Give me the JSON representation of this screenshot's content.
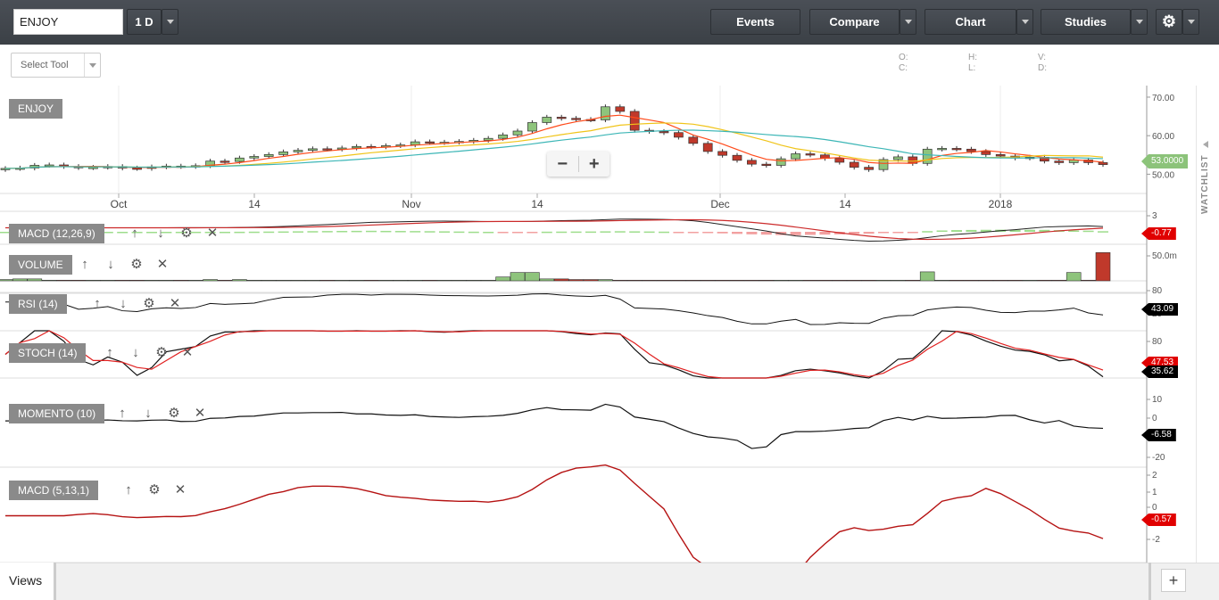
{
  "toolbar": {
    "symbol": "ENJOY",
    "period": "1 D",
    "events": "Events",
    "compare": "Compare",
    "chart": "Chart",
    "studies": "Studies"
  },
  "tools": {
    "select_tool": "Select Tool"
  },
  "ohlc": {
    "o": "O:",
    "h": "H:",
    "v": "V:",
    "c": "C:",
    "l": "L:",
    "d": "D:"
  },
  "main_panel": {
    "label": "ENJOY",
    "y_ticks": [
      "70.00",
      "60.00",
      "50.00"
    ],
    "x_ticks": [
      "Oct",
      "14",
      "Nov",
      "14",
      "Dec",
      "14",
      "2018"
    ],
    "last_price": "53.0000"
  },
  "panels": [
    {
      "label": "MACD (12,26,9)",
      "ticks": [
        "3"
      ],
      "value": "-0.77",
      "controls": [
        "up",
        "down",
        "settings",
        "close"
      ]
    },
    {
      "label": "VOLUME",
      "ticks": [
        "50.0m"
      ],
      "controls": [
        "up",
        "down",
        "settings",
        "close"
      ]
    },
    {
      "label": "RSI (14)",
      "ticks": [
        "80",
        "20"
      ],
      "value": "43.09",
      "controls": [
        "up",
        "down",
        "settings",
        "close"
      ]
    },
    {
      "label": "STOCH (14)",
      "ticks": [
        "80",
        "20"
      ],
      "value": "47.53",
      "value2": "35.62",
      "controls": [
        "up",
        "down",
        "settings",
        "close"
      ]
    },
    {
      "label": "MOMENTO (10)",
      "ticks": [
        "10",
        "0",
        "-10",
        "-20"
      ],
      "value": "-6.58",
      "controls": [
        "up",
        "down",
        "settings",
        "close"
      ]
    },
    {
      "label": "MACD (5,13,1)",
      "ticks": [
        "2",
        "1",
        "0",
        "-1",
        "-2"
      ],
      "value": "-0.57",
      "controls": [
        "up",
        "settings",
        "close"
      ]
    }
  ],
  "zoom": {
    "minus": "−",
    "plus": "+"
  },
  "watchlist": {
    "label": "WATCHLIST"
  },
  "views": {
    "label": "Views",
    "add": "+"
  },
  "colors": {
    "up": "#8ec47c",
    "down": "#c0392b",
    "macd": "#cc2a2a",
    "tag_red": "#e00000",
    "tag_green": "#8cc37a",
    "tag_black": "#000000"
  },
  "chart_data": {
    "type": "candlestick",
    "price_ylim": [
      45,
      73
    ],
    "close": [
      51.5,
      51.6,
      52.3,
      52.4,
      52.0,
      51.7,
      51.8,
      52.0,
      51.6,
      51.5,
      51.9,
      52.1,
      52.0,
      52.2,
      53.4,
      53.3,
      54.2,
      54.6,
      55.1,
      55.8,
      56.2,
      56.6,
      56.5,
      56.8,
      57.2,
      57.1,
      57.4,
      57.6,
      58.4,
      58.2,
      58.3,
      58.5,
      58.8,
      59.3,
      60.2,
      61.2,
      63.4,
      64.8,
      64.5,
      64.2,
      64.1,
      67.5,
      66.3,
      61.4,
      61.1,
      60.8,
      59.6,
      58.0,
      55.9,
      54.9,
      53.6,
      52.6,
      52.3,
      54.0,
      55.3,
      55.0,
      54.1,
      53.1,
      51.8,
      51.2,
      53.8,
      54.5,
      52.8,
      56.5,
      56.7,
      56.5,
      55.9,
      55.1,
      54.7,
      54.2,
      54.4,
      53.4,
      53.0,
      53.7,
      53.0,
      52.5
    ],
    "macd_12_26_9_last": -0.77,
    "volume_m": [
      2,
      3,
      3,
      1,
      1,
      1,
      1,
      1,
      1,
      1,
      1,
      1,
      1,
      1,
      2,
      1,
      2,
      1,
      1,
      1,
      1,
      1,
      1,
      1,
      1,
      1,
      1,
      1,
      1,
      1,
      1,
      1,
      1,
      1,
      6,
      13,
      13,
      3,
      3,
      2,
      2,
      2,
      1,
      1,
      1,
      1,
      1,
      1,
      1,
      1,
      1,
      1,
      1,
      1,
      1,
      1,
      1,
      1,
      1,
      1,
      1,
      1,
      1,
      14,
      1,
      1,
      1,
      1,
      1,
      1,
      1,
      1,
      1,
      13,
      1,
      44
    ],
    "rsi_14_last": 43.09,
    "stoch_14_last": [
      47.53,
      35.62
    ],
    "momento_10_last": -6.58,
    "macd_5_13_1_last": -0.57
  }
}
